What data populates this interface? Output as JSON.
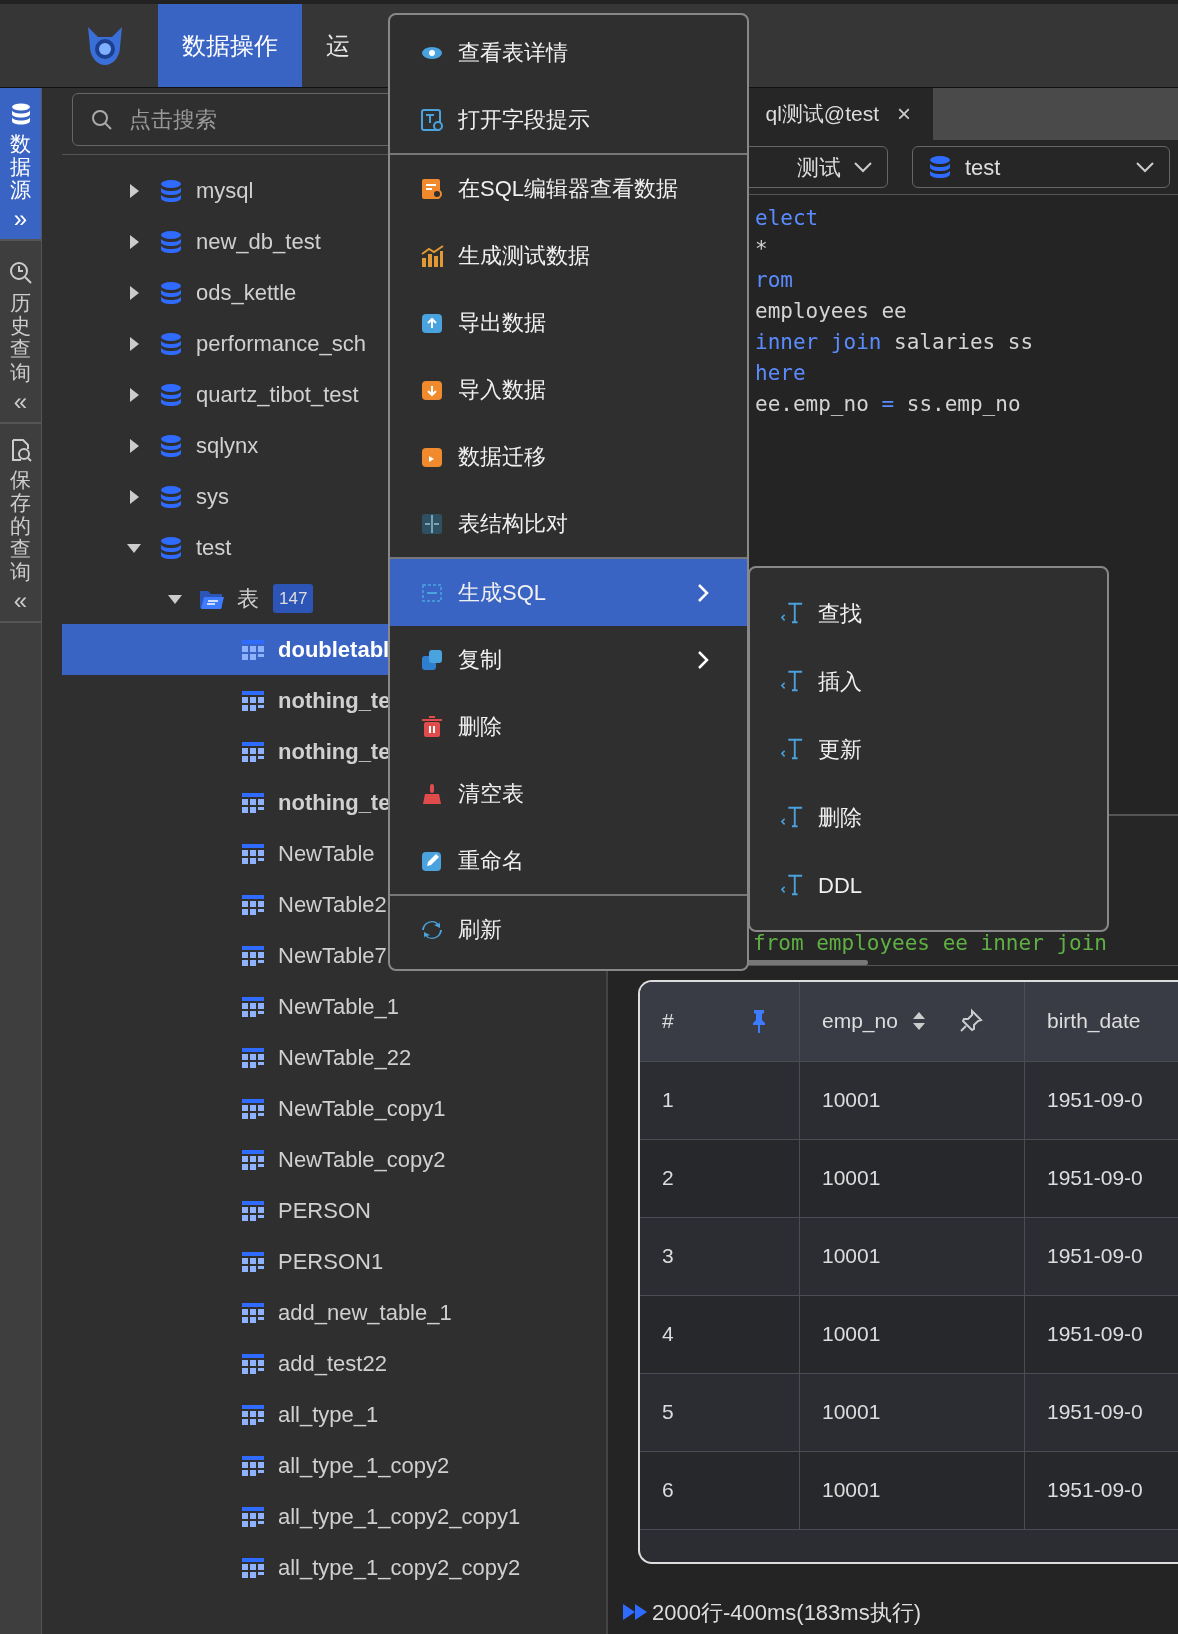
{
  "top_nav": {
    "tabs": [
      {
        "label": "数据操作",
        "selected": true
      },
      {
        "label": "运",
        "selected": false
      }
    ]
  },
  "side_rail": [
    {
      "kind": "datasource",
      "label": "数据源",
      "toggle": "»",
      "selected": true
    },
    {
      "kind": "history",
      "label": "历史查询",
      "toggle": "«",
      "selected": false
    },
    {
      "kind": "saved",
      "label": "保存的查询",
      "toggle": "«",
      "selected": false
    }
  ],
  "tree": {
    "search": {
      "placeholder": "点击搜索"
    },
    "items": [
      {
        "kind": "database",
        "label": "mysql",
        "expanded": false,
        "selected": false
      },
      {
        "kind": "database",
        "label": "new_db_test",
        "expanded": false,
        "selected": false
      },
      {
        "kind": "database",
        "label": "ods_kettle",
        "expanded": false,
        "selected": false
      },
      {
        "kind": "database",
        "label": "performance_sch",
        "expanded": false,
        "selected": false
      },
      {
        "kind": "database",
        "label": "quartz_tibot_test",
        "expanded": false,
        "selected": false
      },
      {
        "kind": "database",
        "label": "sqlynx",
        "expanded": false,
        "selected": false
      },
      {
        "kind": "database",
        "label": "sys",
        "expanded": false,
        "selected": false
      },
      {
        "kind": "database",
        "label": "test",
        "expanded": true,
        "selected": false,
        "children": [
          {
            "kind": "folder",
            "label": "表",
            "badge": "147",
            "expanded": true,
            "selected": false,
            "children": [
              {
                "kind": "table",
                "label": "doubletabl",
                "selected": true,
                "emphasized": true
              },
              {
                "kind": "table",
                "label": "nothing_te",
                "selected": false,
                "emphasized": true
              },
              {
                "kind": "table",
                "label": "nothing_te",
                "selected": false,
                "emphasized": true
              },
              {
                "kind": "table",
                "label": "nothing_te",
                "selected": false,
                "emphasized": true
              },
              {
                "kind": "table",
                "label": "NewTable",
                "selected": false,
                "emphasized": false
              },
              {
                "kind": "table",
                "label": "NewTable2",
                "selected": false,
                "emphasized": false
              },
              {
                "kind": "table",
                "label": "NewTable7",
                "selected": false,
                "emphasized": false
              },
              {
                "kind": "table",
                "label": "NewTable_1",
                "selected": false,
                "emphasized": false
              },
              {
                "kind": "table",
                "label": "NewTable_22",
                "selected": false,
                "emphasized": false
              },
              {
                "kind": "table",
                "label": "NewTable_copy1",
                "selected": false,
                "emphasized": false
              },
              {
                "kind": "table",
                "label": "NewTable_copy2",
                "selected": false,
                "emphasized": false
              },
              {
                "kind": "table",
                "label": "PERSON",
                "selected": false,
                "emphasized": false
              },
              {
                "kind": "table",
                "label": "PERSON1",
                "selected": false,
                "emphasized": false
              },
              {
                "kind": "table",
                "label": "add_new_table_1",
                "selected": false,
                "emphasized": false
              },
              {
                "kind": "table",
                "label": "add_test22",
                "selected": false,
                "emphasized": false
              },
              {
                "kind": "table",
                "label": "all_type_1",
                "selected": false,
                "emphasized": false
              },
              {
                "kind": "table",
                "label": "all_type_1_copy2",
                "selected": false,
                "emphasized": false
              },
              {
                "kind": "table",
                "label": "all_type_1_copy2_copy1",
                "selected": false,
                "emphasized": false
              },
              {
                "kind": "table",
                "label": "all_type_1_copy2_copy2",
                "selected": false,
                "emphasized": false
              }
            ]
          }
        ]
      }
    ]
  },
  "editor": {
    "tab": {
      "title": "ql测试@test",
      "close": "×"
    },
    "connection": "测试",
    "database": "test",
    "code_lines": [
      [
        {
          "kind": "keyword",
          "text": "elect"
        }
      ],
      [
        {
          "kind": "plain",
          "text": "*"
        }
      ],
      [
        {
          "kind": "keyword",
          "text": "rom"
        }
      ],
      [
        {
          "kind": "plain",
          "text": "employees ee"
        }
      ],
      [
        {
          "kind": "keyword",
          "text": "inner join"
        },
        {
          "kind": "plain",
          "text": " salaries ss"
        }
      ],
      [
        {
          "kind": "keyword",
          "text": "here"
        }
      ],
      [
        {
          "kind": "plain",
          "text": "ee.emp_no "
        },
        {
          "kind": "keyword",
          "text": "="
        },
        {
          "kind": "plain",
          "text": " ss.emp_no"
        }
      ]
    ],
    "history_line": "from employees ee inner join"
  },
  "results": {
    "columns": [
      {
        "label": "#",
        "pinned": true
      },
      {
        "label": "emp_no",
        "pinned": false,
        "sortable": true
      },
      {
        "label": "birth_date"
      }
    ],
    "rows": [
      [
        "1",
        "10001",
        "1951-09-0"
      ],
      [
        "2",
        "10001",
        "1951-09-0"
      ],
      [
        "3",
        "10001",
        "1951-09-0"
      ],
      [
        "4",
        "10001",
        "1951-09-0"
      ],
      [
        "5",
        "10001",
        "1951-09-0"
      ],
      [
        "6",
        "10001",
        "1951-09-0"
      ]
    ],
    "status": "2000行-400ms(183ms执行)"
  },
  "context_menu": {
    "groups": [
      [
        {
          "kind": "eye",
          "label": "查看表详情",
          "selected": false,
          "submenu": false
        },
        {
          "kind": "field-hint",
          "label": "打开字段提示",
          "selected": false,
          "submenu": false
        }
      ],
      [
        {
          "kind": "sql-view",
          "label": "在SQL编辑器查看数据",
          "selected": false,
          "submenu": false
        },
        {
          "kind": "chart",
          "label": "生成测试数据",
          "selected": false,
          "submenu": false
        },
        {
          "kind": "export",
          "label": "导出数据",
          "selected": false,
          "submenu": false
        },
        {
          "kind": "import",
          "label": "导入数据",
          "selected": false,
          "submenu": false
        },
        {
          "kind": "migrate",
          "label": "数据迁移",
          "selected": false,
          "submenu": false
        },
        {
          "kind": "compare",
          "label": "表结构比对",
          "selected": false,
          "submenu": false
        }
      ],
      [
        {
          "kind": "sql",
          "label": "生成SQL",
          "selected": true,
          "submenu": true
        },
        {
          "kind": "copy",
          "label": "复制",
          "selected": false,
          "submenu": true
        },
        {
          "kind": "delete",
          "label": "删除",
          "selected": false,
          "submenu": false
        },
        {
          "kind": "clear",
          "label": "清空表",
          "selected": false,
          "submenu": false
        },
        {
          "kind": "rename",
          "label": "重命名",
          "selected": false,
          "submenu": false
        }
      ],
      [
        {
          "kind": "refresh",
          "label": "刷新",
          "selected": false,
          "submenu": false
        }
      ]
    ],
    "submenu": [
      {
        "label": "查找"
      },
      {
        "label": "插入"
      },
      {
        "label": "更新"
      },
      {
        "label": "删除"
      },
      {
        "label": "DDL"
      }
    ]
  }
}
